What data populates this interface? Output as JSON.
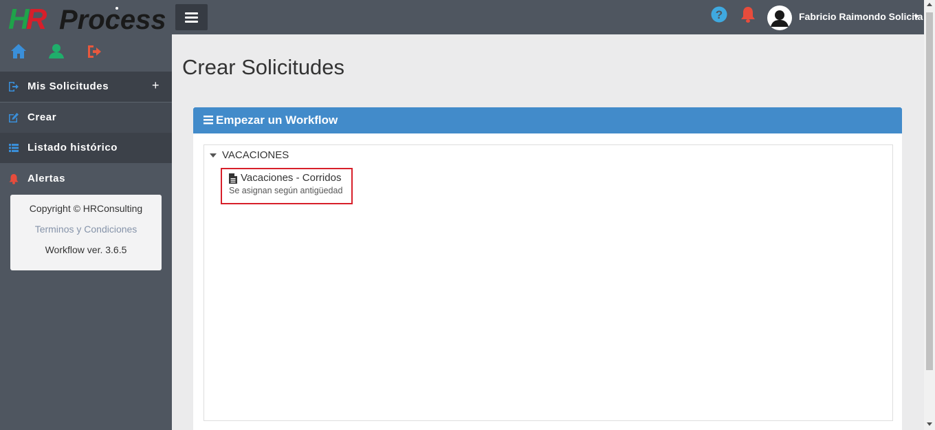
{
  "header": {
    "logo_text": "HRProcess",
    "user_name": "Fabricio Raimondo Solicita"
  },
  "sidebar": {
    "items": [
      {
        "label": "Mis Solicitudes",
        "icon": "sign-in-icon",
        "expand": "+"
      },
      {
        "label": "Crear",
        "icon": "edit-icon"
      },
      {
        "label": "Listado histórico",
        "icon": "list-icon"
      },
      {
        "label": "Alertas",
        "icon": "bell-icon"
      }
    ],
    "footer": {
      "copyright": "Copyright © HRConsulting",
      "terms": "Terminos y Condiciones",
      "version": "Workflow ver. 3.6.5"
    }
  },
  "main": {
    "title": "Crear Solicitudes",
    "panel_title": "Empezar un Workflow",
    "groups": [
      {
        "name": "VACACIONES",
        "items": [
          {
            "title": "Vacaciones - Corridos",
            "description": "Se asignan según antigüedad"
          }
        ]
      }
    ]
  },
  "colors": {
    "sidebar_bg": "#4f5660",
    "panel_heading": "#428bca",
    "highlight_border": "#d71f2a",
    "home_icon": "#3a8fd9",
    "user_icon": "#1fae6b",
    "logout_icon": "#e8583d",
    "help_icon": "#3fa9e0",
    "bell_icon": "#e74c3c"
  }
}
